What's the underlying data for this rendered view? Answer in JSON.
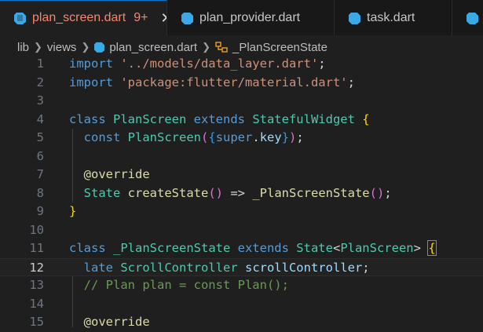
{
  "tabs": [
    {
      "label": "plan_screen.dart",
      "badge": "9+",
      "active": true
    },
    {
      "label": "plan_provider.dart",
      "active": false
    },
    {
      "label": "task.dart",
      "active": false
    }
  ],
  "breadcrumb": [
    "lib",
    "views",
    "plan_screen.dart",
    "_PlanScreenState"
  ],
  "current_line": "12",
  "lines": [
    {
      "num": "1",
      "tokens": [
        [
          "kw",
          "import "
        ],
        [
          "str",
          "'../models/data_layer.dart'"
        ],
        [
          "plain",
          ";"
        ]
      ]
    },
    {
      "num": "2",
      "tokens": [
        [
          "kw",
          "import "
        ],
        [
          "str",
          "'package:flutter/material.dart'"
        ],
        [
          "plain",
          ";"
        ]
      ]
    },
    {
      "num": "3",
      "tokens": []
    },
    {
      "num": "4",
      "tokens": [
        [
          "kw",
          "class "
        ],
        [
          "cls",
          "PlanScreen "
        ],
        [
          "kw",
          "extends "
        ],
        [
          "cls",
          "StatefulWidget "
        ],
        [
          "br1",
          "{"
        ]
      ]
    },
    {
      "num": "5",
      "tokens": [
        [
          "plain",
          "  "
        ],
        [
          "kw",
          "const "
        ],
        [
          "cls",
          "PlanScreen"
        ],
        [
          "br2",
          "("
        ],
        [
          "br3",
          "{"
        ],
        [
          "kw",
          "super"
        ],
        [
          "plain",
          "."
        ],
        [
          "var",
          "key"
        ],
        [
          "br3",
          "}"
        ],
        [
          "br2",
          ")"
        ],
        [
          "plain",
          ";"
        ]
      ]
    },
    {
      "num": "6",
      "tokens": []
    },
    {
      "num": "7",
      "tokens": [
        [
          "plain",
          "  "
        ],
        [
          "fn",
          "@override"
        ]
      ]
    },
    {
      "num": "8",
      "tokens": [
        [
          "plain",
          "  "
        ],
        [
          "cls",
          "State "
        ],
        [
          "fn",
          "createState"
        ],
        [
          "br2",
          "()"
        ],
        [
          "plain",
          " => "
        ],
        [
          "fn",
          "_PlanScreenState"
        ],
        [
          "br2",
          "()"
        ],
        [
          "plain",
          ";"
        ]
      ]
    },
    {
      "num": "9",
      "tokens": [
        [
          "br1",
          "}"
        ]
      ]
    },
    {
      "num": "10",
      "tokens": []
    },
    {
      "num": "11",
      "tokens": [
        [
          "kw",
          "class "
        ],
        [
          "cls",
          "_PlanScreenState "
        ],
        [
          "kw",
          "extends "
        ],
        [
          "cls",
          "State"
        ],
        [
          "plain",
          "<"
        ],
        [
          "cls",
          "PlanScreen"
        ],
        [
          "plain",
          "> "
        ],
        [
          "br1",
          "{"
        ]
      ]
    },
    {
      "num": "12",
      "tokens": [
        [
          "plain",
          "  "
        ],
        [
          "kw",
          "late "
        ],
        [
          "cls",
          "ScrollController "
        ],
        [
          "var",
          "scrollController"
        ],
        [
          "plain",
          ";"
        ]
      ]
    },
    {
      "num": "13",
      "tokens": [
        [
          "plain",
          "  "
        ],
        [
          "cm",
          "// Plan plan = const Plan();"
        ]
      ]
    },
    {
      "num": "14",
      "tokens": []
    },
    {
      "num": "15",
      "tokens": [
        [
          "plain",
          "  "
        ],
        [
          "fn",
          "@override"
        ]
      ]
    }
  ]
}
